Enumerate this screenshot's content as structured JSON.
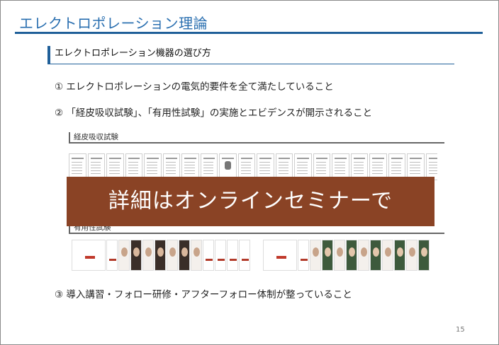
{
  "title": "エレクトロポレーション理論",
  "section": "エレクトロポレーション機器の選び方",
  "items": [
    "① エレクトロポレーションの電気的要件を全て満たしていること",
    "② 「経皮吸収試験」、「有用性試験」の実施とエビデンスが開示されること",
    "③ 導入講習・フォロー研修・アフターフォロー体制が整っていること"
  ],
  "subsections": {
    "absorption_test": "経皮吸収試験",
    "efficacy_test": "有用性試験"
  },
  "overlay": "詳細はオンラインセミナーで",
  "page_number": "15"
}
